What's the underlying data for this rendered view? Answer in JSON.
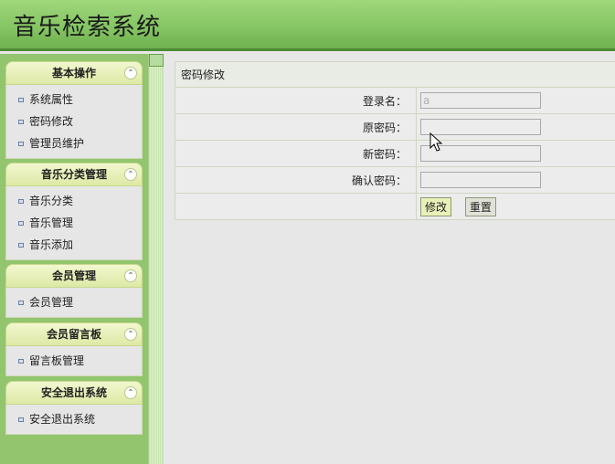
{
  "header": {
    "title": "音乐检索系统"
  },
  "sidebar": {
    "groups": [
      {
        "title": "基本操作",
        "items": [
          "系统属性",
          "密码修改",
          "管理员维护"
        ]
      },
      {
        "title": "音乐分类管理",
        "items": [
          "音乐分类",
          "音乐管理",
          "音乐添加"
        ]
      },
      {
        "title": "会员管理",
        "items": [
          "会员管理"
        ]
      },
      {
        "title": "会员留言板",
        "items": [
          "留言板管理"
        ]
      },
      {
        "title": "安全退出系统",
        "items": [
          "安全退出系统"
        ]
      }
    ],
    "collapse_glyph": "⌃",
    "icons": {
      "collapse": "collapse-up-icon",
      "bullet": "square-bullet-icon"
    }
  },
  "form": {
    "title": "密码修改",
    "fields": [
      {
        "label": "登录名：",
        "value": "a"
      },
      {
        "label": "原密码：",
        "value": ""
      },
      {
        "label": "新密码：",
        "value": ""
      },
      {
        "label": "确认密码：",
        "value": ""
      }
    ],
    "submit_label": "修改",
    "reset_label": "重置"
  },
  "colors": {
    "header": "#86c664",
    "sidebar": "#92c56e",
    "menu_header": "#e6efb8",
    "content_bg": "#e7e7e7"
  }
}
